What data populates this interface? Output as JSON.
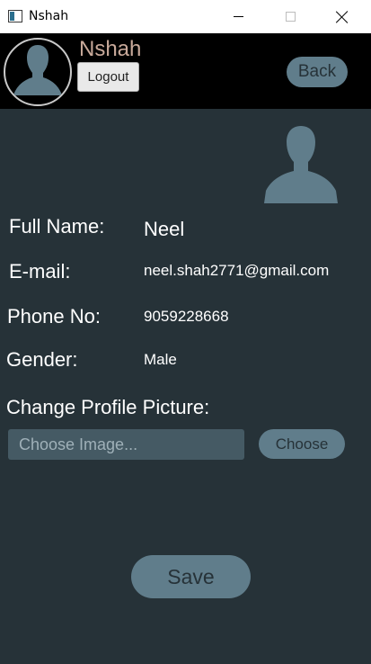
{
  "window": {
    "title": "Nshah"
  },
  "header": {
    "username": "Nshah",
    "logout_label": "Logout",
    "back_label": "Back"
  },
  "profile": {
    "fields": [
      {
        "label": "Full Name:",
        "value": "Neel"
      },
      {
        "label": "E-mail:",
        "value": "neel.shah2771@gmail.com"
      },
      {
        "label": "Phone No:",
        "value": "9059228668"
      },
      {
        "label": "Gender:",
        "value": "Male"
      }
    ]
  },
  "picture": {
    "section_label": "Change Profile Picture:",
    "input_placeholder": "Choose Image...",
    "choose_label": "Choose"
  },
  "actions": {
    "save_label": "Save"
  },
  "colors": {
    "background": "#263238",
    "header": "#000000",
    "button_accent": "#607d8b",
    "input_bg": "#455a64",
    "username_color": "#c8a99a"
  }
}
